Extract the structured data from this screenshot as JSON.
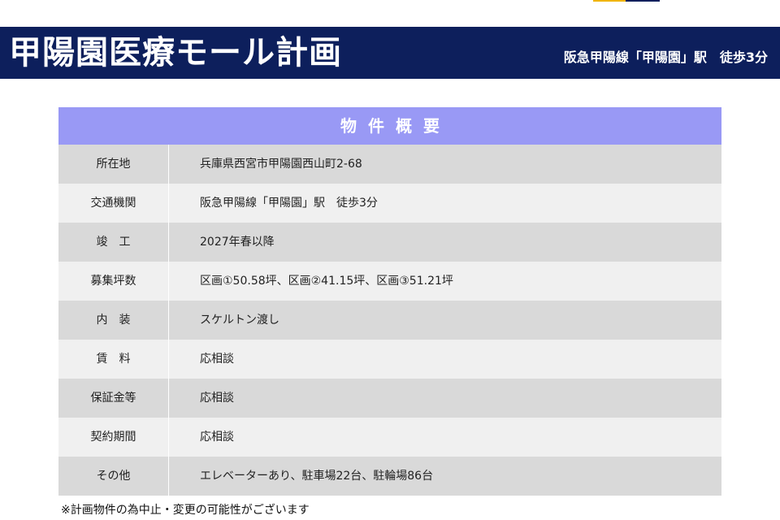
{
  "header": {
    "main_title": "甲陽園医療モール計画",
    "access_summary": "阪急甲陽線「甲陽園」駅　徒歩3分"
  },
  "summary": {
    "heading": "物件概要",
    "rows": [
      {
        "label": "所在地",
        "value": "兵庫県西宮市甲陽園西山町2-68"
      },
      {
        "label": "交通機関",
        "value": "阪急甲陽線「甲陽園」駅　徒歩3分"
      },
      {
        "label": "竣　工",
        "value": "2027年春以降"
      },
      {
        "label": "募集坪数",
        "value": "区画①50.58坪、区画②41.15坪、区画③51.21坪"
      },
      {
        "label": "内　装",
        "value": "スケルトン渡し"
      },
      {
        "label": "賃　料",
        "value": "応相談"
      },
      {
        "label": "保証金等",
        "value": "応相談"
      },
      {
        "label": "契約期間",
        "value": "応相談"
      },
      {
        "label": "その他",
        "value": "エレベーターあり、駐車場22台、駐輪場86台"
      }
    ]
  },
  "footnote": "※計画物件の為中止・変更の可能性がございます",
  "colors": {
    "title_bar": "#0d1f5c",
    "table_header": "#9999f5",
    "row_dark": "#d9d9d9",
    "row_light": "#f0f0f0",
    "accent_gold": "#f0b400"
  }
}
